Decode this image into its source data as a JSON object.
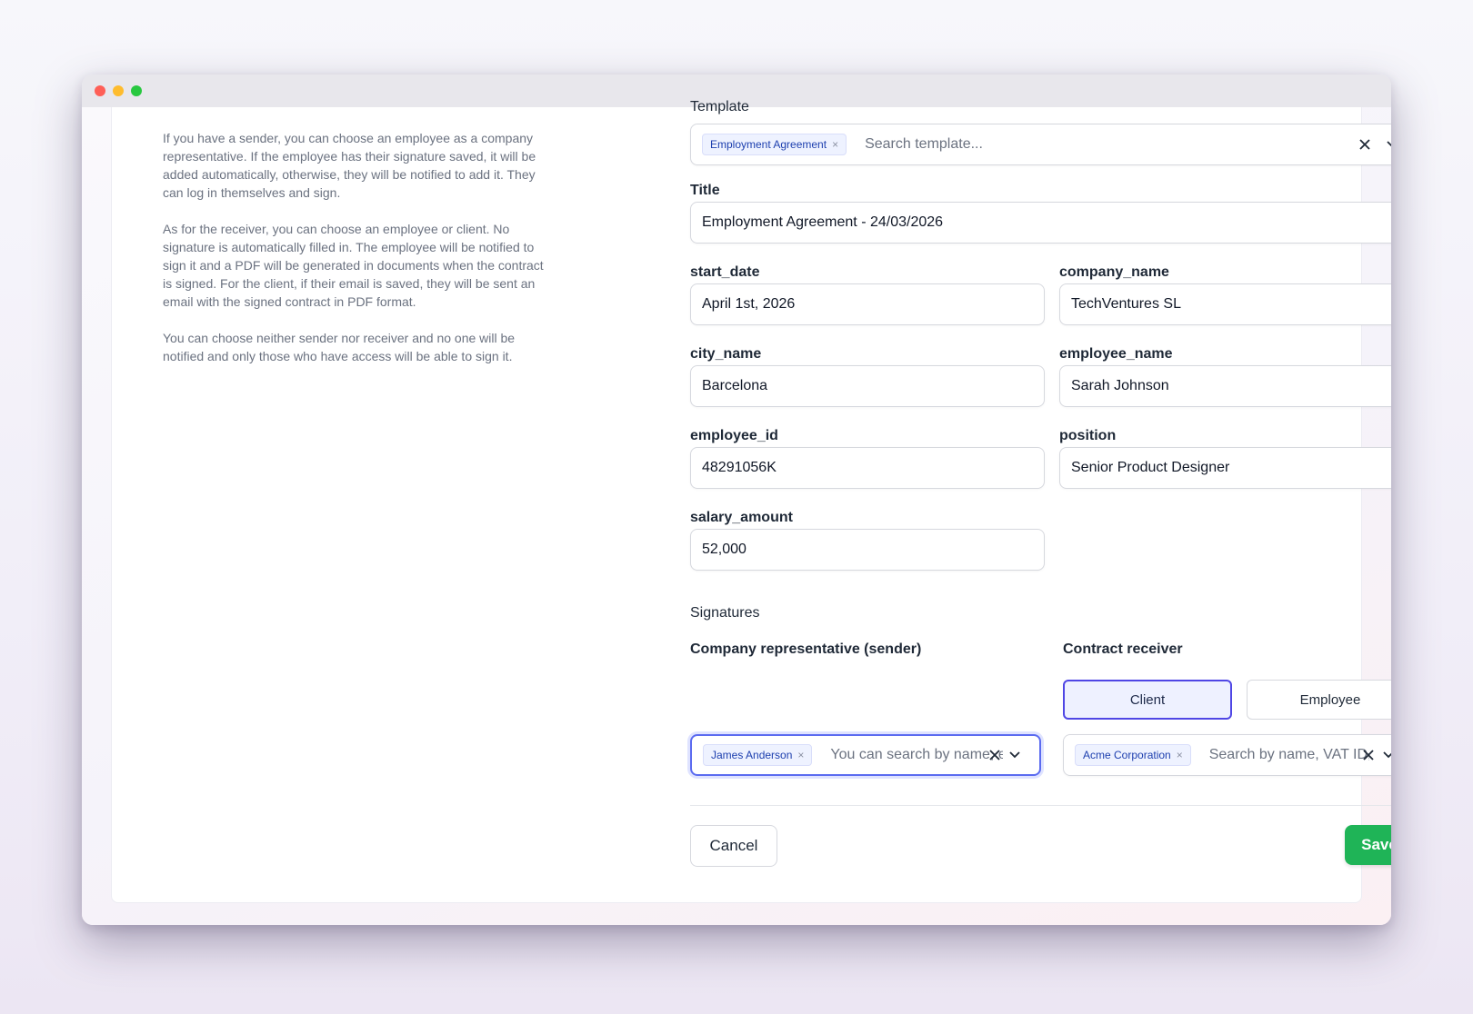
{
  "help": {
    "paragraph_1": "If you have a sender, you can choose an employee as a company representative. If the employee has their signature saved, it will be added automatically, otherwise, they will be notified to add it. They can log in themselves and sign.",
    "paragraph_2": "As for the receiver, you can choose an employee or client. No signature is automatically filled in. The employee will be notified to sign it and a PDF will be generated in documents when the contract is signed. For the client, if their email is saved, they will be sent an email with the signed contract in PDF format.",
    "paragraph_3": "You can choose neither sender nor receiver and no one will be notified and only those who have access will be able to sign it."
  },
  "form": {
    "template": {
      "label": "Template",
      "chip": "Employment Agreement",
      "chip_remove": "×",
      "placeholder": "Search template..."
    },
    "title": {
      "label": "Title",
      "value": "Employment Agreement - 24/03/2026"
    },
    "fields": {
      "start_date": {
        "label": "start_date",
        "value": "April 1st, 2026"
      },
      "company_name": {
        "label": "company_name",
        "value": "TechVentures SL"
      },
      "city_name": {
        "label": "city_name",
        "value": "Barcelona"
      },
      "employee_name": {
        "label": "employee_name",
        "value": "Sarah Johnson"
      },
      "employee_id": {
        "label": "employee_id",
        "value": "48291056K"
      },
      "position": {
        "label": "position",
        "value": "Senior Product Designer"
      },
      "salary_amount": {
        "label": "salary_amount",
        "value": "52,000"
      }
    }
  },
  "signatures": {
    "title": "Signatures",
    "sender": {
      "label": "Company representative (sender)",
      "chip": "James Anderson",
      "chip_remove": "×",
      "placeholder": "You can search by name, e"
    },
    "receiver": {
      "label": "Contract receiver",
      "options": [
        "Client",
        "Employee"
      ],
      "selected": "Client",
      "chip": "Acme Corporation",
      "chip_remove": "×",
      "placeholder": "Search by name, VAT ID, e"
    }
  },
  "actions": {
    "cancel": "Cancel",
    "save": "Save"
  },
  "colors": {
    "accent": "#4f46e5",
    "save": "#1fb457",
    "chip_text": "#1e40af"
  }
}
